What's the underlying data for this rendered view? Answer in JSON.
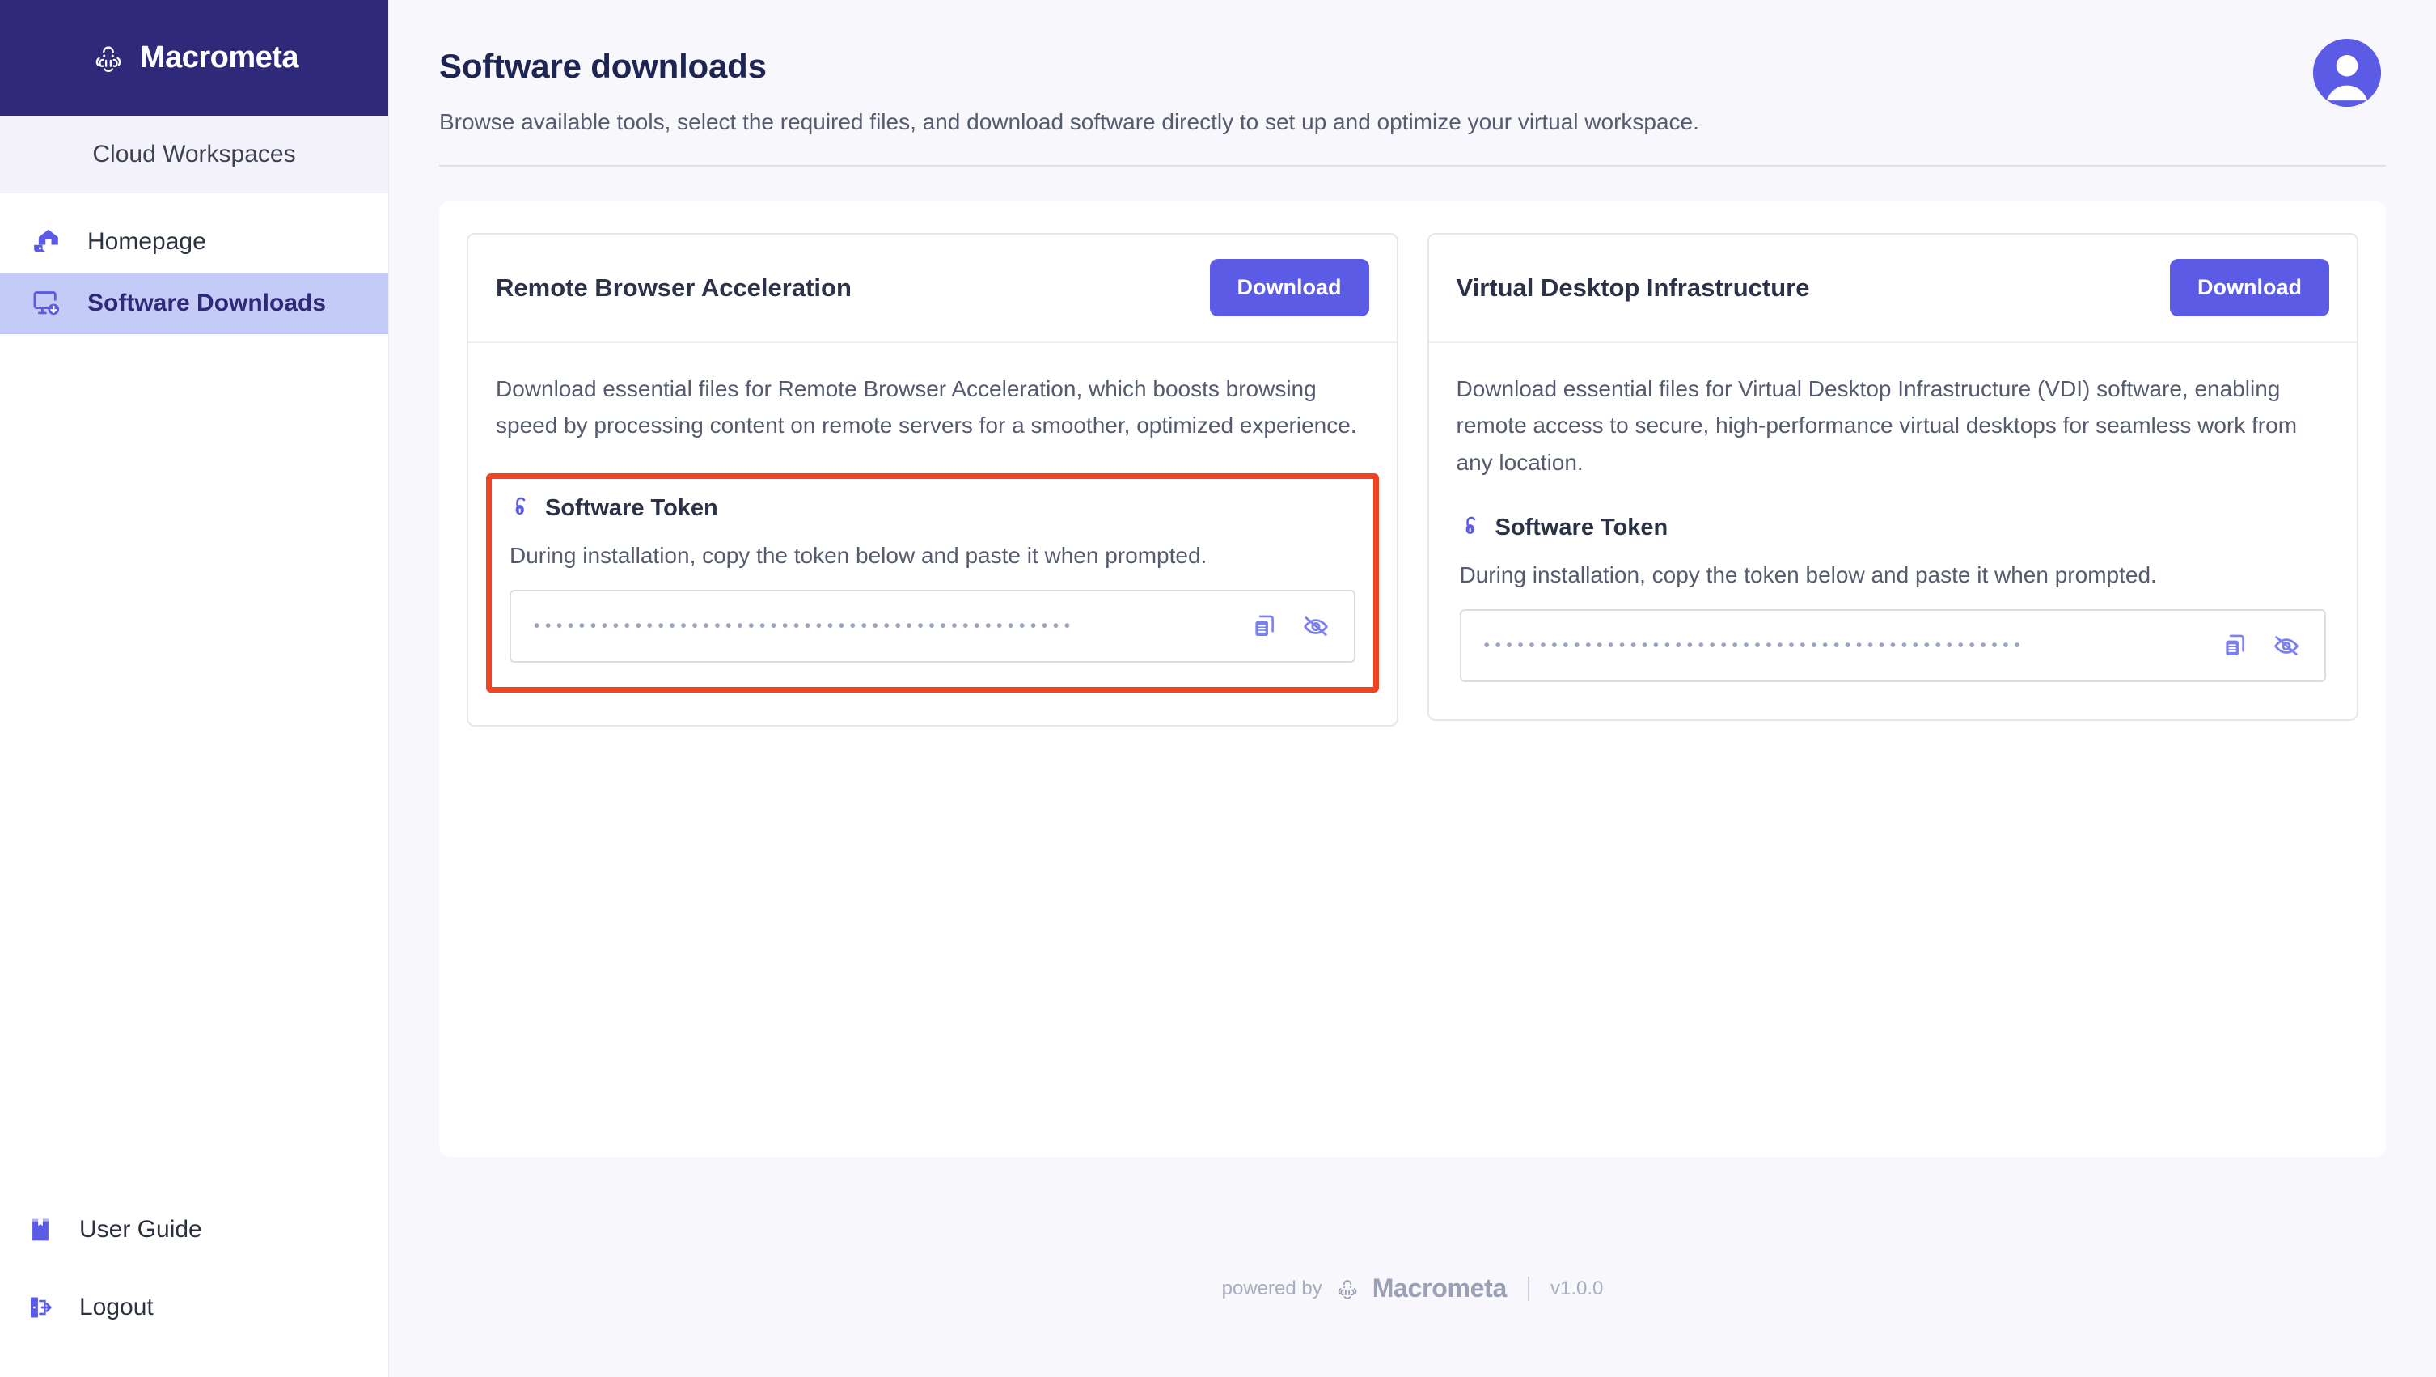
{
  "brand": {
    "name": "Macrometa",
    "logo_icon": "octopus-logo-icon",
    "workspaces_label": "Cloud Workspaces"
  },
  "sidebar": {
    "items": [
      {
        "label": "Homepage",
        "icon": "home-laptop-icon",
        "active": false
      },
      {
        "label": "Software Downloads",
        "icon": "monitor-download-icon",
        "active": true
      }
    ],
    "bottom_items": [
      {
        "label": "User Guide",
        "icon": "book-icon"
      },
      {
        "label": "Logout",
        "icon": "logout-icon"
      }
    ]
  },
  "header": {
    "title": "Software downloads",
    "subtitle": "Browse available tools, select the required files, and download software directly to set up and optimize your virtual workspace.",
    "avatar_icon": "user-avatar-icon"
  },
  "cards": [
    {
      "title": "Remote Browser Acceleration",
      "download_label": "Download",
      "description": "Download essential files for Remote Browser Acceleration, which boosts browsing speed by processing content on remote servers for a smoother, optimized experience.",
      "token": {
        "lock_icon": "unlock-icon",
        "label": "Software Token",
        "hint": "During installation, copy the token below and paste it when prompted.",
        "masked_value": "••••••••••••••••••••••••••••••••••••••••••••••••",
        "copy_icon": "copy-icon",
        "visibility_icon": "eye-off-icon",
        "highlighted": true
      }
    },
    {
      "title": "Virtual Desktop Infrastructure",
      "download_label": "Download",
      "description": "Download essential files for Virtual Desktop Infrastructure (VDI) software, enabling remote access to secure, high-performance virtual desktops for seamless work from any location.",
      "token": {
        "lock_icon": "unlock-icon",
        "label": "Software Token",
        "hint": "During installation, copy the token below and paste it when prompted.",
        "masked_value": "••••••••••••••••••••••••••••••••••••••••••••••••",
        "copy_icon": "copy-icon",
        "visibility_icon": "eye-off-icon",
        "highlighted": false
      }
    }
  ],
  "footer": {
    "powered_by": "powered by",
    "brand": "Macrometa",
    "version": "v1.0.0",
    "logo_icon": "octopus-logo-icon"
  },
  "colors": {
    "brand_dark": "#2e2a79",
    "accent": "#5b5be6",
    "active_nav_bg": "#c5cbf7",
    "highlight_red": "#f04323",
    "page_bg": "#f8f7fc"
  }
}
